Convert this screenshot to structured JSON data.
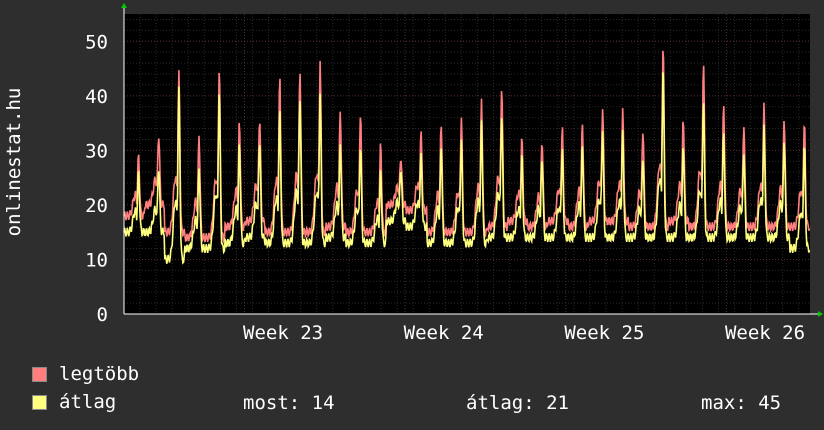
{
  "chart_data": {
    "type": "area",
    "ylabel": "onlinestat.hu",
    "ylim": [
      0,
      55
    ],
    "yticks": [
      0,
      10,
      20,
      30,
      40,
      50
    ],
    "x_range_days": [
      0,
      42.7
    ],
    "x_ticks": [
      {
        "label": "Week 23",
        "day": 9.9
      },
      {
        "label": "Week 24",
        "day": 19.9
      },
      {
        "label": "Week 25",
        "day": 29.9
      },
      {
        "label": "Week 26",
        "day": 39.9
      }
    ],
    "series": [
      {
        "name": "legtöbb",
        "color": "#ff7f7f",
        "daily_peaks": [
          29,
          33,
          44,
          33,
          45,
          35,
          36,
          43,
          45,
          46,
          37,
          37,
          31,
          29,
          33,
          35,
          36,
          39,
          42,
          32,
          32,
          34,
          35,
          38,
          37,
          34,
          49,
          36,
          46,
          38,
          35,
          38,
          36,
          35
        ],
        "baseline": [
          18,
          20,
          15,
          14,
          14,
          16,
          17,
          15,
          15,
          15,
          16,
          15,
          15,
          20,
          19,
          15,
          15,
          15,
          16,
          17,
          16,
          17,
          16,
          17,
          17,
          16,
          16,
          17,
          16,
          16,
          16,
          16,
          16,
          16
        ]
      },
      {
        "name": "átlag",
        "color": "#ffff80",
        "daily_peaks": [
          26,
          27,
          41,
          27,
          41,
          31,
          32,
          37,
          40,
          40,
          31,
          31,
          26,
          27,
          29,
          31,
          32,
          35,
          37,
          29,
          29,
          30,
          31,
          34,
          33,
          29,
          45,
          31,
          39,
          33,
          30,
          34,
          32,
          31
        ],
        "baseline": [
          15,
          15,
          10,
          12,
          12,
          13,
          14,
          13,
          13,
          13,
          14,
          13,
          13,
          17,
          16,
          13,
          13,
          13,
          14,
          14,
          14,
          14,
          14,
          14,
          14,
          14,
          14,
          14,
          14,
          14,
          14,
          14,
          14,
          12
        ]
      }
    ]
  },
  "legend": [
    {
      "label": "legtöbb",
      "color": "#ff7f7f"
    },
    {
      "label": "átlag",
      "color": "#ffff80"
    }
  ],
  "stats": {
    "now": "most: 14",
    "avg": "átlag: 21",
    "max": "max: 45"
  }
}
